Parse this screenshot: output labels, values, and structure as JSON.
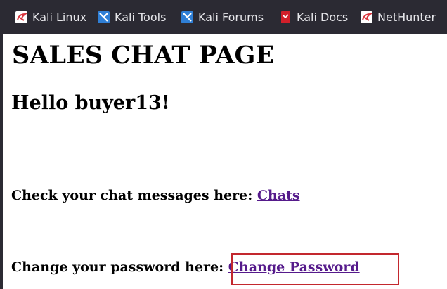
{
  "bookmarks": [
    {
      "label": "Kali Linux",
      "icon": "kali-dragon-icon"
    },
    {
      "label": "Kali Tools",
      "icon": "kali-tools-icon"
    },
    {
      "label": "Kali Forums",
      "icon": "kali-forums-icon"
    },
    {
      "label": "Kali Docs",
      "icon": "kali-docs-icon"
    },
    {
      "label": "NetHunter",
      "icon": "nethunter-icon"
    }
  ],
  "page": {
    "title": "SALES CHAT PAGE",
    "greeting": "Hello buyer13!",
    "chats_prompt": "Check your chat messages here: ",
    "chats_link": "Chats",
    "password_prompt": "Change your password here: ",
    "password_link": "Change Password"
  },
  "colors": {
    "toolbar_bg": "#2b2a33",
    "link_visited": "#551a8b",
    "highlight_border": "#c3282e"
  }
}
